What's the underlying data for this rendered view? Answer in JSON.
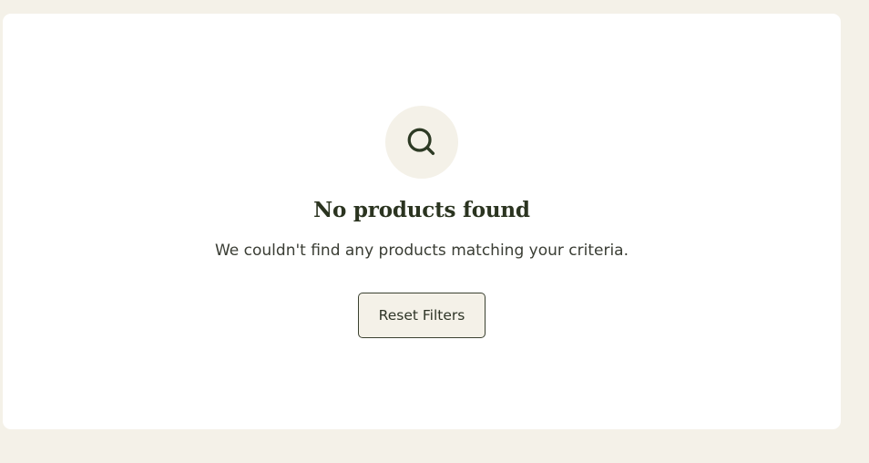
{
  "empty_state": {
    "icon": "search-icon",
    "title": "No products found",
    "message": "We couldn't find any products matching your criteria.",
    "reset_label": "Reset Filters"
  },
  "colors": {
    "background": "#f4f1e8",
    "card": "#ffffff",
    "text_dark": "#2b3420",
    "accent_border": "#3b4130"
  }
}
